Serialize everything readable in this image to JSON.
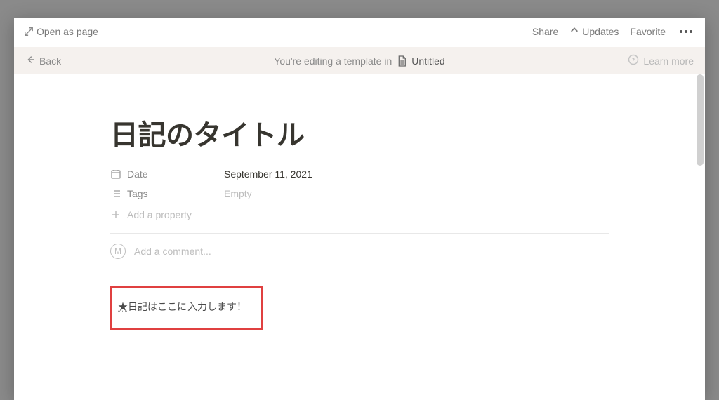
{
  "topbar": {
    "open_as_page": "Open as page",
    "share": "Share",
    "updates": "Updates",
    "favorite": "Favorite"
  },
  "template_bar": {
    "back": "Back",
    "editing_prefix": "You're editing a template in",
    "template_name": "Untitled",
    "learn_more": "Learn more"
  },
  "page": {
    "title": "日記のタイトル",
    "properties": [
      {
        "icon": "date",
        "label": "Date",
        "value": "September 11, 2021",
        "empty": false
      },
      {
        "icon": "tags",
        "label": "Tags",
        "value": "Empty",
        "empty": true
      }
    ],
    "add_property": "Add a property",
    "comment": {
      "avatar_initial": "M",
      "placeholder": "Add a comment..."
    },
    "body": {
      "star": "★",
      "text_part1": "日記はここに",
      "text_part2": "入力します！"
    }
  }
}
